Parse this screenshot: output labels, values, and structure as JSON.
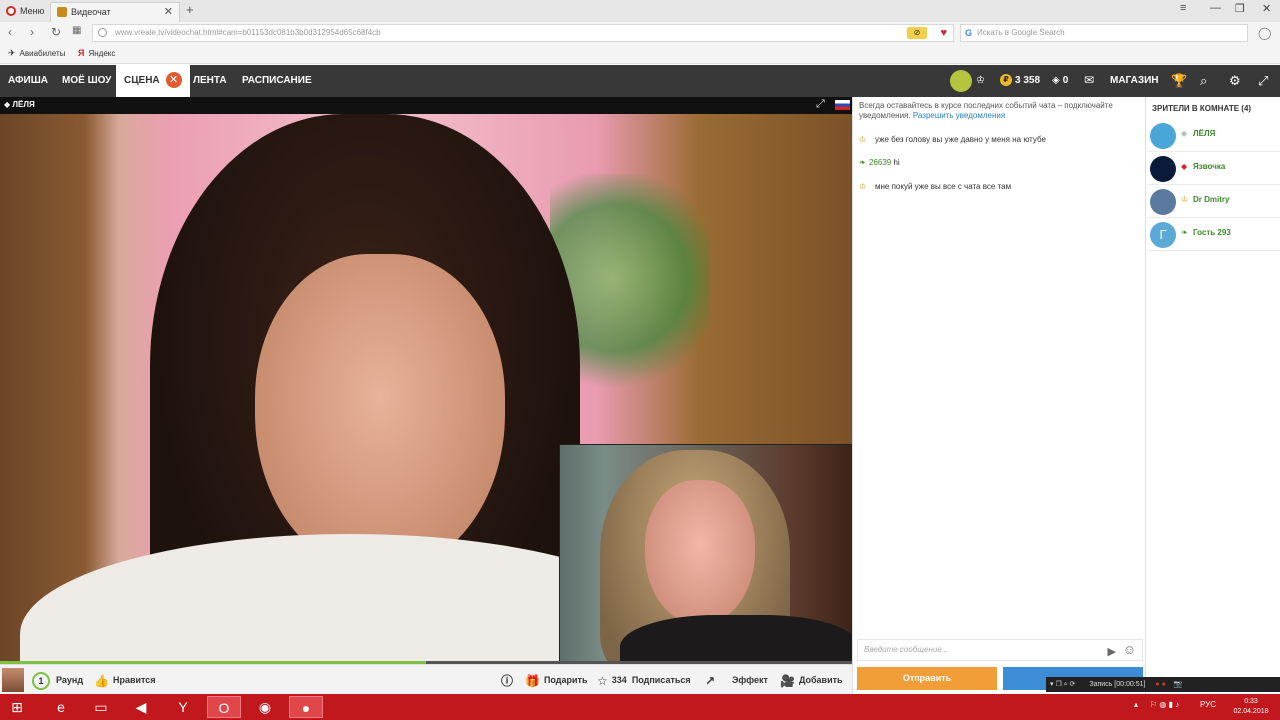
{
  "browser": {
    "menu_label": "Меню",
    "tab_title": "Видеочат",
    "url": "www.vreale.tv/videochat.html#cam=b01153dc081b3b0d312954d65c68f4cb",
    "search_placeholder": "Искать в Google Search",
    "bookmarks": [
      "Авиабилеты",
      "Яндекс"
    ]
  },
  "site_nav": {
    "items": [
      "АФИША",
      "МОЁ ШОУ",
      "СЦЕНА",
      "ЛЕНТА",
      "РАСПИСАНИЕ"
    ],
    "coins": "3 358",
    "diamonds": "0",
    "shop": "МАГАЗИН"
  },
  "video": {
    "performer_name": "ЛЁЛЯ",
    "progress_fraction": 0.5
  },
  "controls": {
    "round_number": "1",
    "round_label": "Раунд",
    "like_label": "Нравится",
    "gift_label": "Подарить",
    "subscribers": "334",
    "subscribe_label": "Подписаться",
    "effect_label": "Эффект",
    "add_label": "Добавить"
  },
  "chat": {
    "notice_text": "Всегда оставайтесь в курсе последних событий чата – подключайте уведомления.",
    "notice_link": "Разрешить уведомления",
    "messages": [
      {
        "nick": "",
        "text": "уже без голову вы уже давно у меня на ютубе"
      },
      {
        "nick": "26639",
        "text": "hi"
      },
      {
        "nick": "",
        "text": "мне покуй уже вы все с чата все там"
      }
    ],
    "input_placeholder": "Введите сообщение...",
    "send_label": "Отправить"
  },
  "viewers": {
    "title": "ЗРИТЕЛИ В КОМНАТЕ (4)",
    "list": [
      {
        "name": "ЛЁЛЯ",
        "color": "#4aa6d8"
      },
      {
        "name": "Язвочка",
        "color": "#0a1a3a"
      },
      {
        "name": "Dr Dmitry",
        "color": "#5a7aa0"
      },
      {
        "name": "Гость 293",
        "initial": "Г",
        "color": "#5aa9d6"
      }
    ]
  },
  "recording": {
    "text": "Запись [00:00:51]"
  },
  "taskbar": {
    "lang": "РУС",
    "time": "0:33",
    "date": "02.04.2018"
  }
}
